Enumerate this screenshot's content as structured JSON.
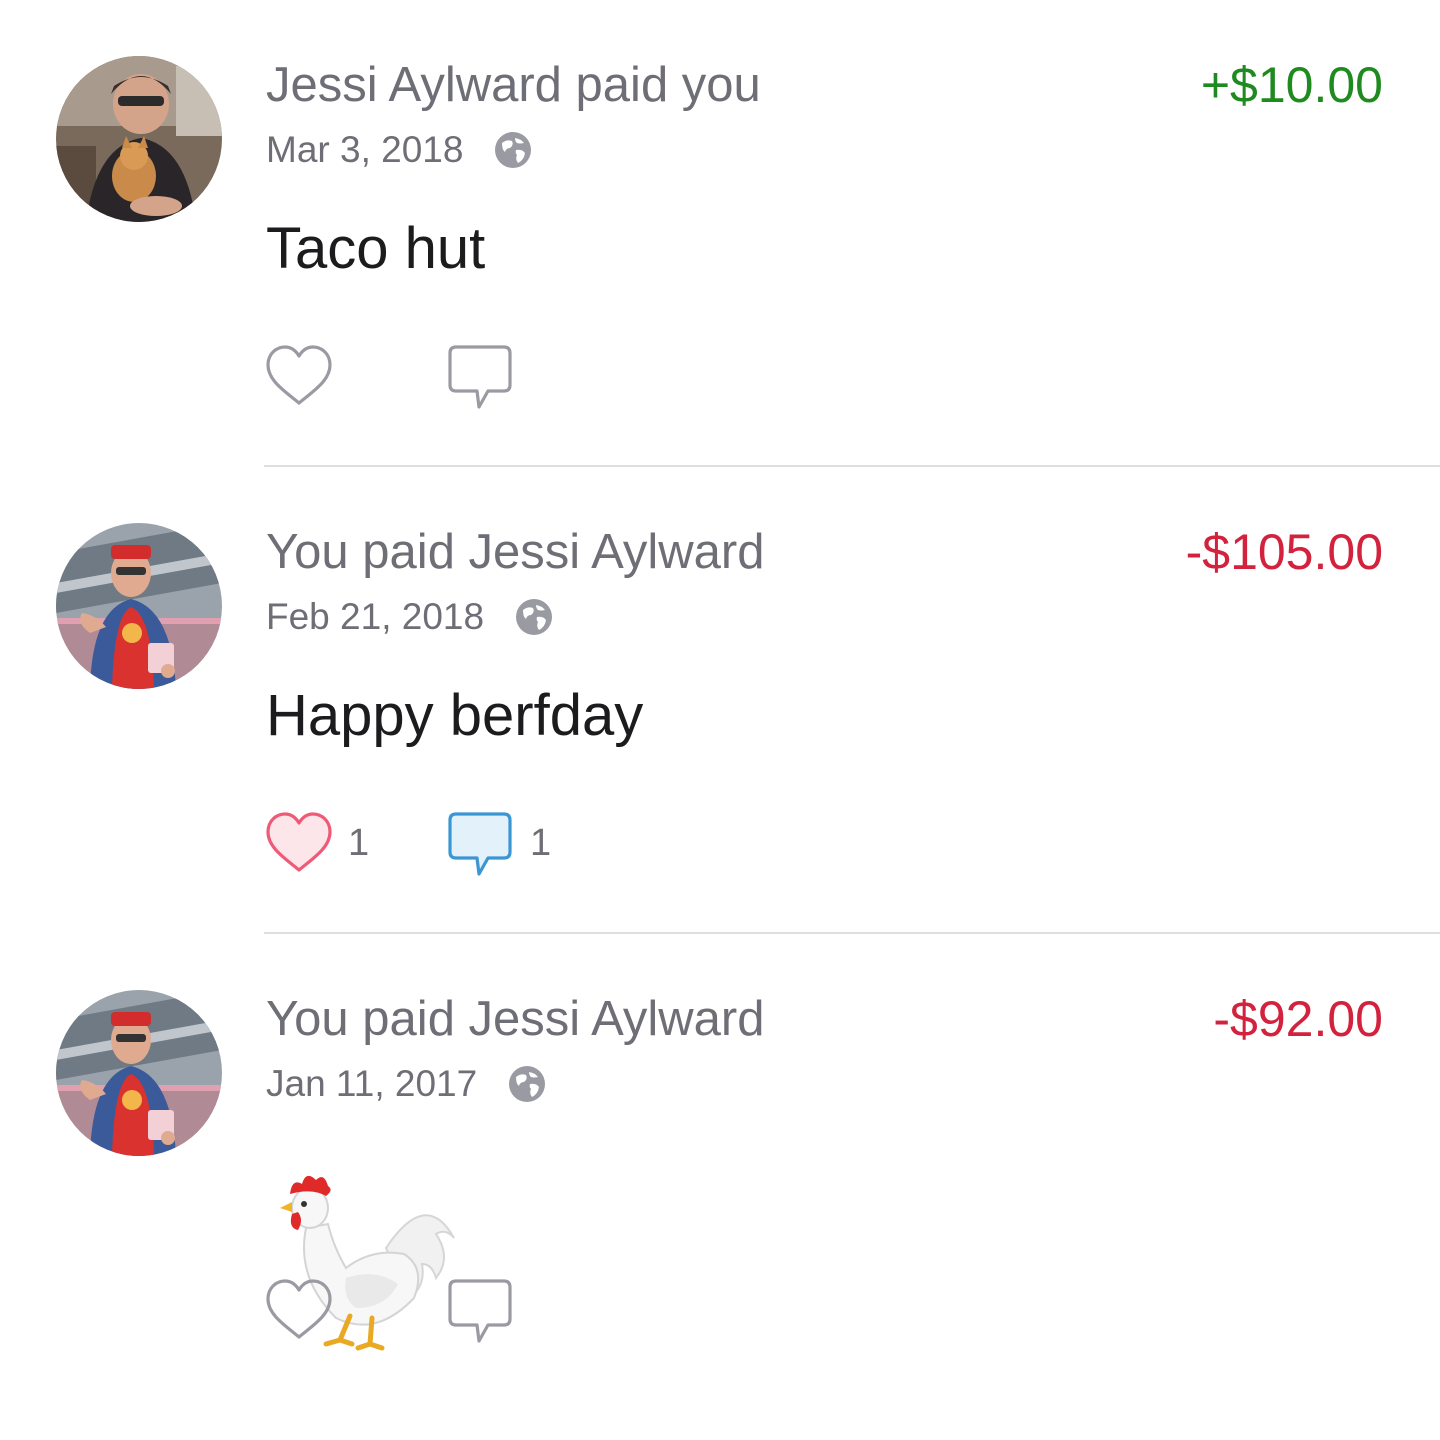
{
  "feed": {
    "transactions": [
      {
        "avatar": "avatar-woman-with-dog",
        "title": "Jessi Aylward paid you",
        "amount": "+$10.00",
        "amount_color": "#1f8a20",
        "date": "Mar 3, 2018",
        "visibility_icon": "globe-icon",
        "note": "Taco hut",
        "like_icon": "heart-icon",
        "comment_icon": "comment-icon",
        "liked": false,
        "commented": false,
        "like_count": "",
        "comment_count": ""
      },
      {
        "avatar": "avatar-man-red-shirt",
        "title": "You paid Jessi Aylward",
        "amount": "-$105.00",
        "amount_color": "#d3223e",
        "date": "Feb 21, 2018",
        "visibility_icon": "globe-icon",
        "note": "Happy berfday",
        "like_icon": "heart-icon",
        "comment_icon": "comment-icon",
        "liked": true,
        "commented": true,
        "like_count": "1",
        "comment_count": "1"
      },
      {
        "avatar": "avatar-man-red-shirt",
        "title": "You paid Jessi Aylward",
        "amount": "-$92.00",
        "amount_color": "#d3223e",
        "date": "Jan 11, 2017",
        "visibility_icon": "globe-icon",
        "note_emoji": "rooster-emoji",
        "like_icon": "heart-icon",
        "comment_icon": "comment-icon",
        "liked": false,
        "commented": false,
        "like_count": "",
        "comment_count": ""
      }
    ]
  }
}
